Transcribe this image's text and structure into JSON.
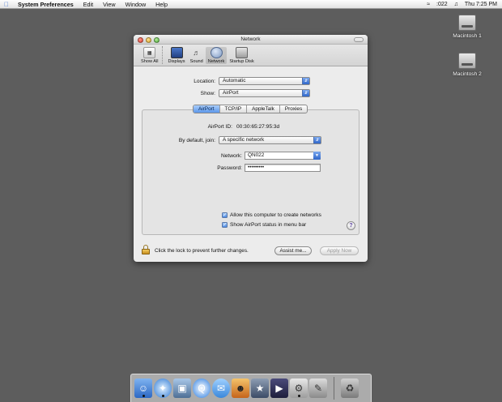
{
  "menubar": {
    "apple": "",
    "app_name": "System Preferences",
    "menus": [
      "Edit",
      "View",
      "Window",
      "Help"
    ],
    "status": {
      "airport_value": ":022",
      "clock": "Thu 7:25 PM"
    }
  },
  "desktop": {
    "disks": [
      "Macintosh 1",
      "Macintosh 2"
    ]
  },
  "window": {
    "title": "Network",
    "toolbar": [
      {
        "label": "Show All",
        "icon": "show-all-icon"
      },
      {
        "label": "Displays",
        "icon": "displays-icon"
      },
      {
        "label": "Sound",
        "icon": "sound-icon"
      },
      {
        "label": "Network",
        "icon": "network-icon",
        "selected": true
      },
      {
        "label": "Startup Disk",
        "icon": "startup-disk-icon"
      }
    ],
    "location": {
      "label": "Location:",
      "value": "Automatic"
    },
    "show": {
      "label": "Show:",
      "value": "AirPort"
    },
    "tabs": [
      "AirPort",
      "TCP/IP",
      "AppleTalk",
      "Proxies"
    ],
    "active_tab": "AirPort",
    "airport_id": {
      "label": "AirPort ID:",
      "value": "00:30:65:27:95:3d"
    },
    "default_join": {
      "label": "By default, join:",
      "value": "A specific network"
    },
    "network": {
      "label": "Network:",
      "value": "QN022"
    },
    "password": {
      "label": "Password:",
      "value": "•••••••••"
    },
    "checkboxes": [
      {
        "label": "Allow this computer to create networks",
        "checked": true
      },
      {
        "label": "Show AirPort status in menu bar",
        "checked": true
      }
    ],
    "help": "?",
    "lock_text": "Click the lock to prevent further changes.",
    "assist_button": "Assist me...",
    "apply_button": "Apply Now"
  },
  "dock": {
    "items": [
      "finder-icon",
      "safari-icon",
      "preview-icon",
      "quicktime-icon",
      "ichat-icon",
      "iphoto-icon",
      "imovie-icon",
      "system-preferences-icon",
      "mail-icon",
      "trash-icon"
    ]
  },
  "colors": {
    "desktop": "#5d5d5d",
    "accent": "#3d7ddc"
  }
}
